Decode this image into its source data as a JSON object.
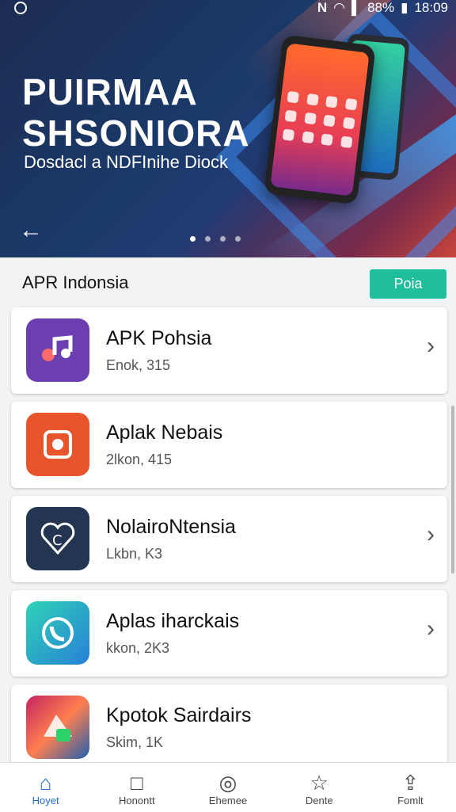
{
  "status": {
    "carrier": "N",
    "battery": "88%",
    "time": "18:09"
  },
  "hero": {
    "title_line1": "PUIRMAA",
    "title_line2": "SHSONIORA",
    "subtitle": "Dosdacl a NDFInihe Diock",
    "carousel_dots": 4,
    "active_dot": 1
  },
  "section": {
    "title": "APR Indonsia",
    "action": "Poia"
  },
  "apps": [
    {
      "name": "APK Pohsia",
      "meta": "Enok, 315"
    },
    {
      "name": "Aplak Nebais",
      "meta": "2lkon, 415"
    },
    {
      "name": "NolairoNtensia",
      "meta": "Lkbn, K3"
    },
    {
      "name": "Aplas iharckais",
      "meta": "kkon, 2K3"
    },
    {
      "name": "Kpotok Sairdairs",
      "meta": "Skim, 1K"
    }
  ],
  "bottom_nav": [
    {
      "label": "Hoyet",
      "icon": "home-icon"
    },
    {
      "label": "Honontt",
      "icon": "document-icon"
    },
    {
      "label": "Ehemee",
      "icon": "compass-icon"
    },
    {
      "label": "Dente",
      "icon": "star-icon"
    },
    {
      "label": "Fomlt",
      "icon": "share-icon"
    }
  ],
  "colors": {
    "accent": "#1fbf9c",
    "nav_active": "#1c6ed6"
  }
}
